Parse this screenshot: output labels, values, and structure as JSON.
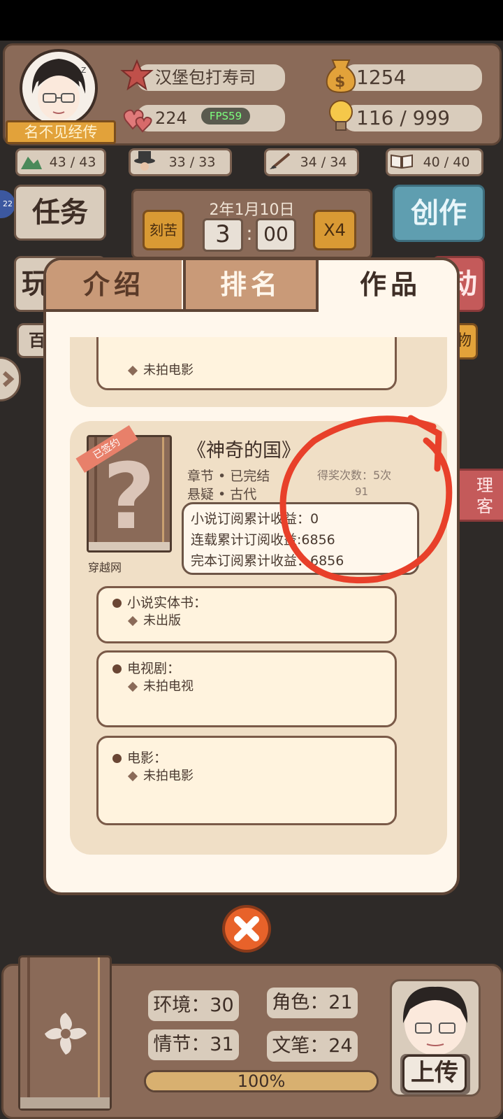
{
  "player": {
    "name": "名不见经传",
    "title": "汉堡包打寿司",
    "hearts": "224",
    "fps": "FPS59",
    "money": "1254",
    "ideas": "116 / 999"
  },
  "resources": [
    {
      "icon": "mountain-icon",
      "value": "43 / 43"
    },
    {
      "icon": "hat-icon",
      "value": "33 / 33"
    },
    {
      "icon": "brush-icon",
      "value": "34 / 34"
    },
    {
      "icon": "book-icon",
      "value": "40 / 40"
    }
  ],
  "left_buttons": {
    "task": "任务",
    "play": "玩",
    "hundred": "百"
  },
  "right_buttons": {
    "create": "创作",
    "active": "动",
    "items": "物",
    "manage": "理\n客"
  },
  "side_badge": "22",
  "date": {
    "text": "2年1月10日",
    "diligent": "刻苦",
    "hour": "3",
    "minute": "00",
    "speed": "X4"
  },
  "tabs": [
    "介绍",
    "排名",
    "作品"
  ],
  "active_tab": 2,
  "works": [
    {
      "film": "未拍电影"
    },
    {
      "signed": "已签约",
      "cover_mark": "?",
      "site": "穿越网",
      "title": "《神奇的国》",
      "tags": [
        "章节 • 已完结",
        "悬疑 • 古代"
      ],
      "awards_label": "得奖次数：5次",
      "awards_extra": "91",
      "income": [
        "小说订阅累计收益：0",
        "连载累计订阅收益:6856",
        "完本订阅累计收益：6856"
      ],
      "physical": {
        "label": "小说实体书：",
        "value": "未出版"
      },
      "tv": {
        "label": "电视剧：",
        "value": "未拍电视"
      },
      "film": {
        "label": "电影：",
        "value": "未拍电影"
      }
    }
  ],
  "bottom": {
    "stats": {
      "env": "环境：30",
      "role": "角色：21",
      "plot": "情节：31",
      "writing": "文笔：24"
    },
    "progress": "100%",
    "progress_value": 1.0,
    "upload": "上传"
  },
  "colors": {
    "annotation": "#e8402a",
    "close": "#e8622a"
  }
}
